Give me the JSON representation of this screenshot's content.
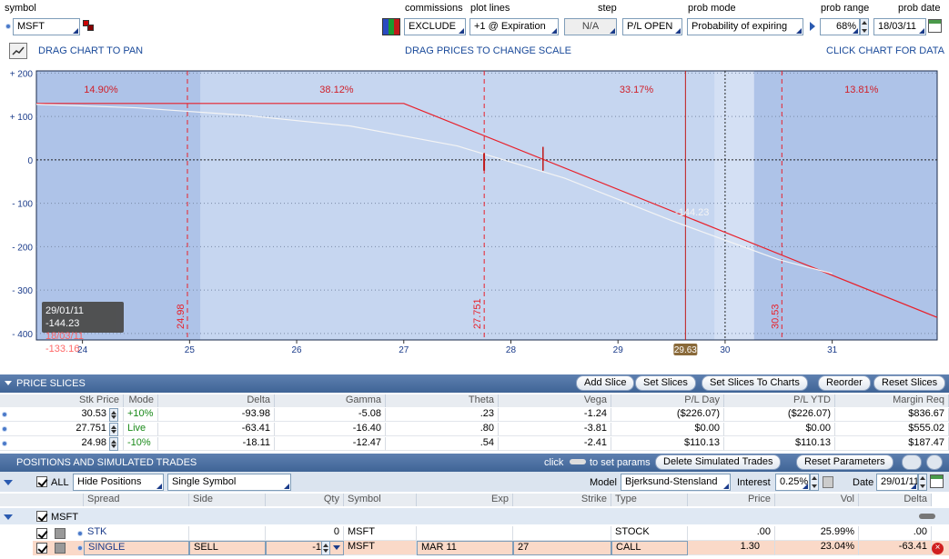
{
  "toolbar": {
    "symbol_label": "symbol",
    "symbol_value": "MSFT",
    "commissions_label": "commissions",
    "commissions_value": "EXCLUDE",
    "plot_lines_label": "plot lines",
    "plot_lines_value": "+1 @ Expiration",
    "step_label": "step",
    "step_value": "N/A",
    "pl_open_value": "P/L OPEN",
    "prob_mode_label": "prob mode",
    "prob_mode_value": "Probability of expiring",
    "prob_range_label": "prob range",
    "prob_range_value": "68%",
    "prob_date_label": "prob date",
    "prob_date_value": "18/03/11"
  },
  "hints": {
    "pan": "DRAG CHART TO PAN",
    "scale": "DRAG PRICES TO CHANGE SCALE",
    "data": "CLICK CHART FOR DATA"
  },
  "chart_data": {
    "type": "line",
    "x_ticks": [
      "24",
      "25",
      "26",
      "27",
      "28",
      "29",
      "30",
      "31"
    ],
    "y_ticks": [
      "+ 200",
      "+ 100",
      "0",
      "- 100",
      "- 200",
      "- 300",
      "- 400"
    ],
    "xlim": [
      23.57,
      31.98
    ],
    "ylim": [
      -415,
      205
    ],
    "series": [
      {
        "name": "expiration",
        "color": "#e8202a",
        "x": [
          23.57,
          27.0,
          31.98
        ],
        "y": [
          130,
          130,
          -363
        ]
      },
      {
        "name": "today",
        "color": "#f4f4f4",
        "x": [
          23.57,
          24.5,
          25.5,
          26.5,
          27.5,
          28.5,
          29.5,
          30.5,
          31.0
        ],
        "y": [
          128,
          120,
          103,
          78,
          32,
          -42,
          -140,
          -230,
          -262
        ]
      }
    ],
    "prob_pcts": [
      "14.90%",
      "38.12%",
      "33.17%",
      "13.81%"
    ],
    "slice_labels": [
      "24.98",
      "27.751",
      "30.53"
    ],
    "current_price": "29.63",
    "readout_line1": "29/01/11  -144.23",
    "readout_line2": "18/03/11  -133.16",
    "cursor_value": "-144.23"
  },
  "price_slices": {
    "title": "PRICE SLICES",
    "buttons": [
      "Add Slice",
      "Set Slices",
      "Set Slices To Charts",
      "Reorder",
      "Reset Slices"
    ],
    "columns": [
      "Stk Price",
      "Mode",
      "Delta",
      "Gamma",
      "Theta",
      "Vega",
      "P/L Day",
      "P/L YTD",
      "Margin Req"
    ],
    "rows": [
      [
        "30.53",
        "+10%",
        "-93.98",
        "-5.08",
        ".23",
        "-1.24",
        "($226.07)",
        "($226.07)",
        "$836.67"
      ],
      [
        "27.751",
        "Live",
        "-63.41",
        "-16.40",
        ".80",
        "-3.81",
        "$0.00",
        "$0.00",
        "$555.02"
      ],
      [
        "24.98",
        "-10%",
        "-18.11",
        "-12.47",
        ".54",
        "-2.41",
        "$110.13",
        "$110.13",
        "$187.47"
      ]
    ]
  },
  "positions": {
    "title": "POSITIONS AND SIMULATED TRADES",
    "click_text": "click",
    "set_params_text": "to set params",
    "delete_button": "Delete Simulated Trades",
    "reset_button": "Reset Parameters",
    "all_label": "ALL",
    "hide_positions": "Hide Positions",
    "single_symbol": "Single Symbol",
    "model_label": "Model",
    "model_value": "Bjerksund-Stensland",
    "interest_label": "Interest",
    "interest_value": "0.25%",
    "date_label": "Date",
    "date_value": "29/01/11",
    "columns": [
      "Spread",
      "Side",
      "Qty",
      "Symbol",
      "Exp",
      "Strike",
      "Type",
      "Price",
      "Vol",
      "Delta"
    ],
    "group": "MSFT",
    "rows": [
      [
        "STK",
        "",
        "0",
        "MSFT",
        "",
        "",
        "STOCK",
        ".00",
        "25.99%",
        ".00"
      ],
      [
        "SINGLE",
        "SELL",
        "-1",
        "MSFT",
        "MAR 11",
        "27",
        "CALL",
        "1.30",
        "23.04%",
        "-63.41"
      ]
    ]
  }
}
